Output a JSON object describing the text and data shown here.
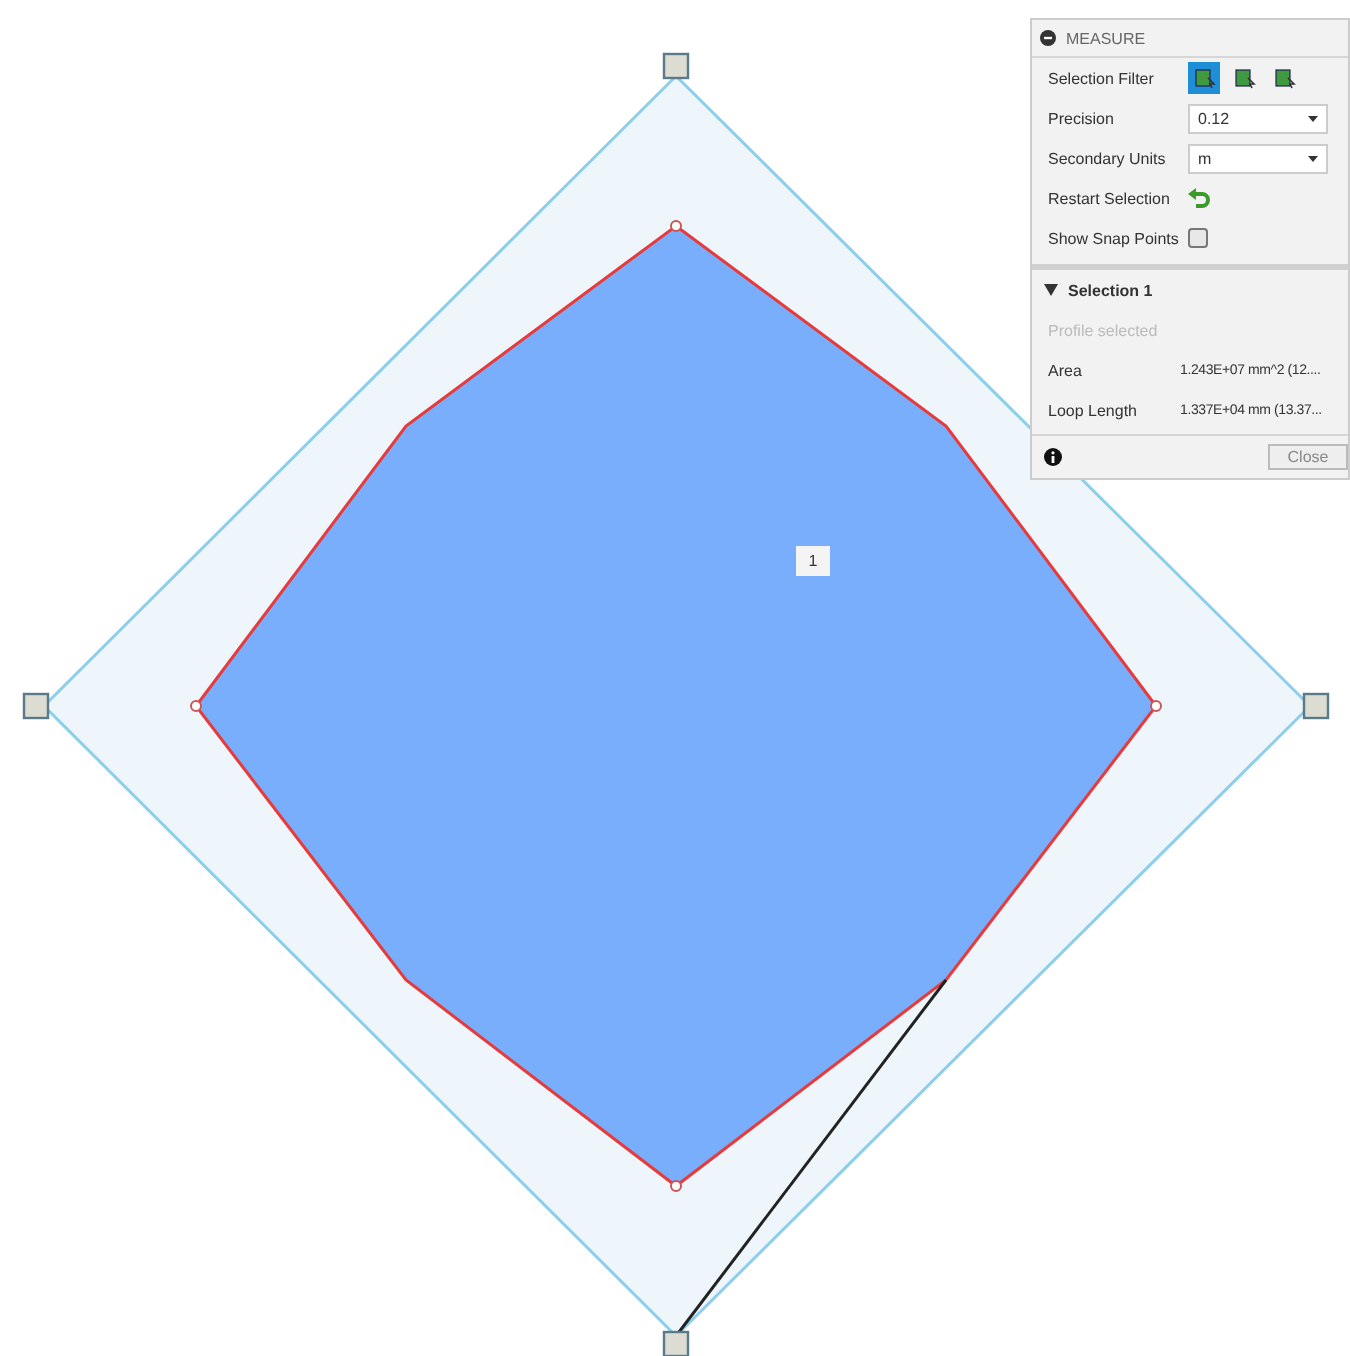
{
  "canvas": {
    "profile_label": "1"
  },
  "panel": {
    "title": "MEASURE",
    "settings": [
      {
        "kind": "filter",
        "label": "Selection Filter",
        "filters": [
          {
            "selected": true
          },
          {
            "selected": false
          },
          {
            "selected": false
          }
        ]
      },
      {
        "kind": "dropdown",
        "label": "Precision",
        "value": "0.12"
      },
      {
        "kind": "dropdown",
        "label": "Secondary Units",
        "value": "m"
      },
      {
        "kind": "action",
        "label": "Restart Selection"
      },
      {
        "kind": "checkbox",
        "label": "Show Snap Points",
        "checked": false
      }
    ],
    "selection": {
      "title": "Selection 1",
      "expanded": true,
      "status": "Profile selected",
      "results": [
        {
          "label": "Area",
          "value": "1.243E+07 mm^2 (12...."
        },
        {
          "label": "Loop Length",
          "value": "1.337E+04 mm (13.37..."
        }
      ]
    },
    "close_button": "Close"
  }
}
